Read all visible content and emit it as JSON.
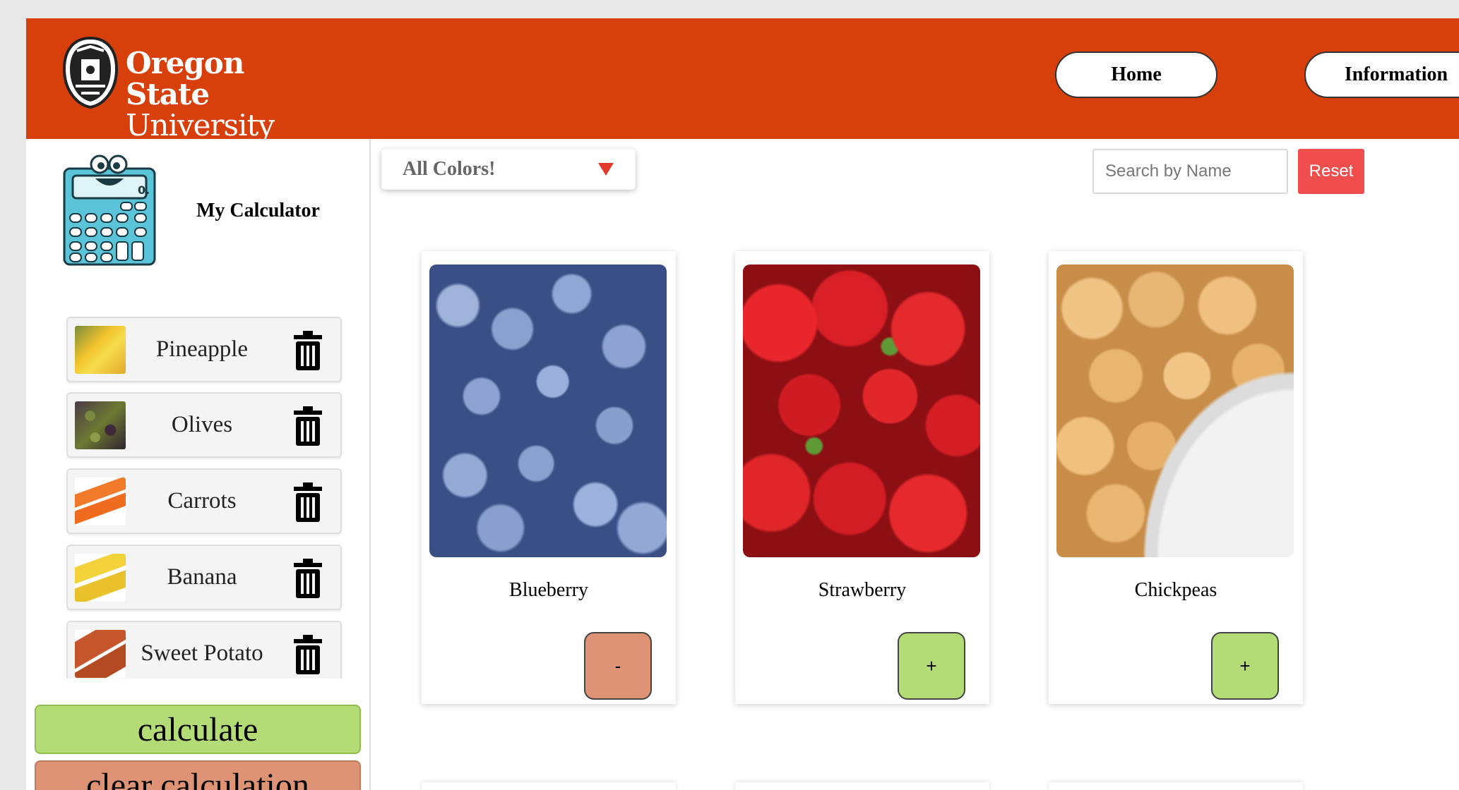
{
  "header": {
    "logo_line1": "Oregon State",
    "logo_line2": "University",
    "nav": [
      {
        "label": "Home"
      },
      {
        "label": "Information"
      }
    ],
    "bg_color": "#d73f0b"
  },
  "sidebar": {
    "calculator_title": "My Calculator",
    "items": [
      {
        "name": "Pineapple"
      },
      {
        "name": "Olives"
      },
      {
        "name": "Carrots"
      },
      {
        "name": "Banana"
      },
      {
        "name": "Sweet Potato"
      }
    ],
    "calculate_label": "calculate",
    "clear_label": "clear calculation"
  },
  "filters": {
    "color_selected": "All Colors!",
    "search_placeholder": "Search by Name",
    "search_value": "",
    "reset_label": "Reset"
  },
  "cards": [
    {
      "name": "Blueberry",
      "action": "-"
    },
    {
      "name": "Strawberry",
      "action": "+"
    },
    {
      "name": "Chickpeas",
      "action": "+"
    }
  ],
  "colors": {
    "header": "#d73f0b",
    "add": "#b3dc77",
    "remove": "#de9375",
    "reset": "#f04d4d"
  }
}
